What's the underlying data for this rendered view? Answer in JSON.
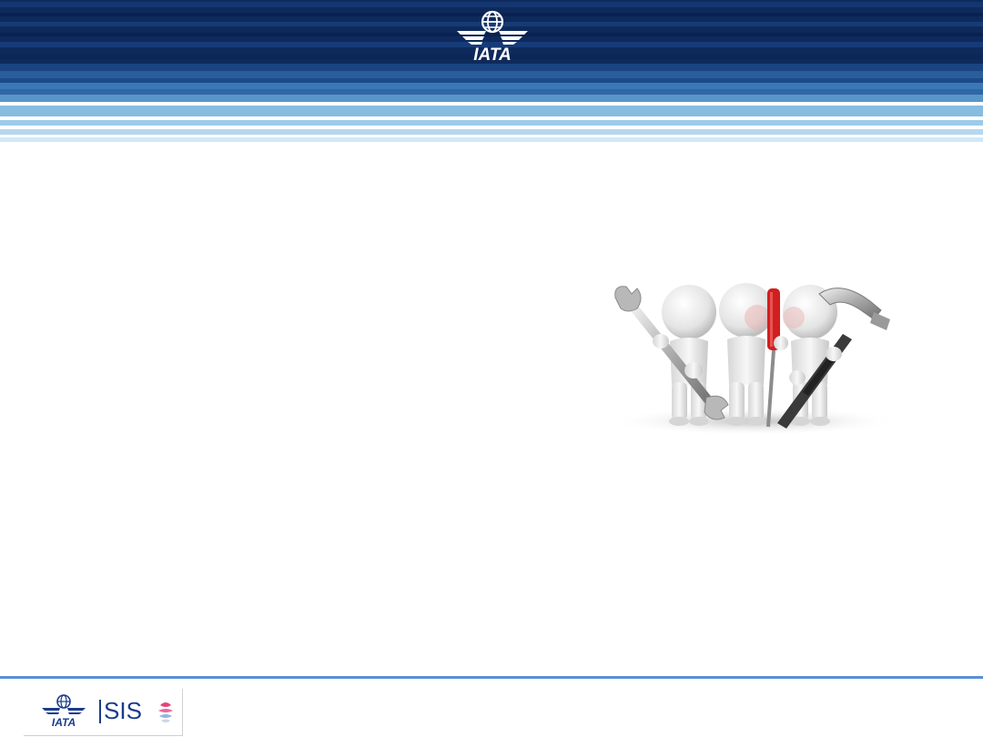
{
  "header": {
    "logo_text": "IATA",
    "logo_icon": "iata-globe-wings-icon",
    "colors": {
      "dark_navy": "#0c2350",
      "navy": "#133467",
      "mid_blue": "#2f6aa8",
      "light_blue": "#8fc1e4",
      "pale_blue": "#c9e3f3"
    }
  },
  "illustration": {
    "icon": "three-figures-with-tools-icon"
  },
  "footer": {
    "iata_logo_text": "IATA",
    "product_name": "SIS",
    "rule_color": "#5b8fd8",
    "brand_color": "#1a3c8c"
  }
}
